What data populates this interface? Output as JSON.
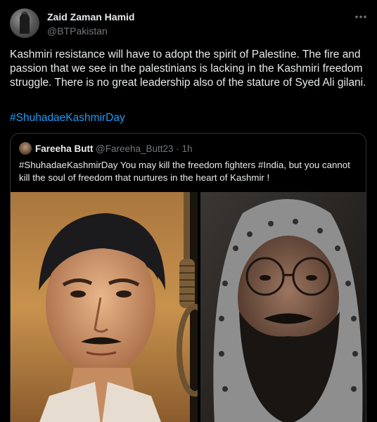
{
  "tweet": {
    "author": {
      "name": "Zaid Zaman Hamid",
      "handle": "@BTPakistan"
    },
    "text": "Kashmiri resistance will have to adopt the spirit of Palestine. The fire and passion that we see in the palestinians is lacking in the Kashmiri freedom struggle. There is no great leadership also of the stature of Syed Ali gilani.",
    "hashtag": "#ShuhadaeKashmirDay",
    "more_icon": "more-horizontal-icon"
  },
  "quoted": {
    "author": {
      "name": "Fareeha Butt",
      "handle": "@Fareeha_Butt23",
      "time": "· 1h"
    },
    "text": "#ShuhadaeKashmirDay You may kill the freedom fighters #India, but you cannot kill the soul of freedom that nurtures in the heart of Kashmir !"
  },
  "colors": {
    "background": "#000000",
    "text_primary": "#e7e9ea",
    "text_secondary": "#71767b",
    "link": "#1d9bf0",
    "border": "#2f3336"
  }
}
